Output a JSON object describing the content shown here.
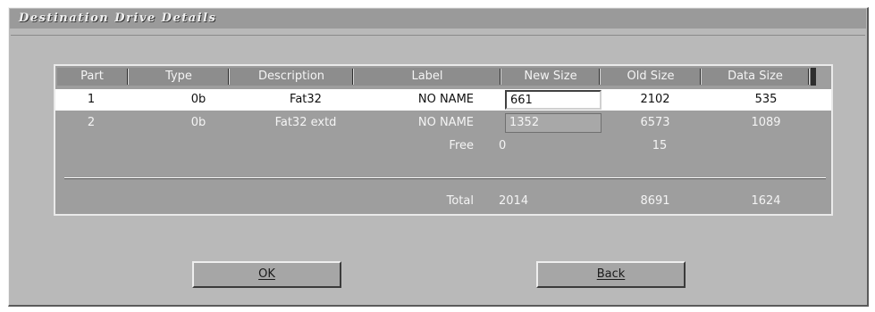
{
  "window": {
    "title": "Destination Drive Details"
  },
  "table": {
    "columns": [
      "Part",
      "Type",
      "Description",
      "Label",
      "New Size",
      "Old Size",
      "Data Size"
    ],
    "rows": [
      {
        "part": "1",
        "type": "0b",
        "description": "Fat32",
        "label": "NO NAME",
        "new_size": "661",
        "old_size": "2102",
        "data_size": "535",
        "selected": true
      },
      {
        "part": "2",
        "type": "0b",
        "description": "Fat32 extd",
        "label": "NO NAME",
        "new_size": "1352",
        "old_size": "6573",
        "data_size": "1089",
        "selected": false
      }
    ],
    "free": {
      "label": "Free",
      "new_size": "0",
      "old_size": "15"
    },
    "total": {
      "label": "Total",
      "new_size": "2014",
      "old_size": "8691",
      "data_size": "1624"
    }
  },
  "buttons": {
    "ok": "OK",
    "back": "Back"
  },
  "colors": {
    "dialog_bg": "#b9b9b9",
    "panel_bg": "#9e9e9e",
    "header_bg": "#8d8d8d",
    "selected_row": "#ffffff"
  }
}
